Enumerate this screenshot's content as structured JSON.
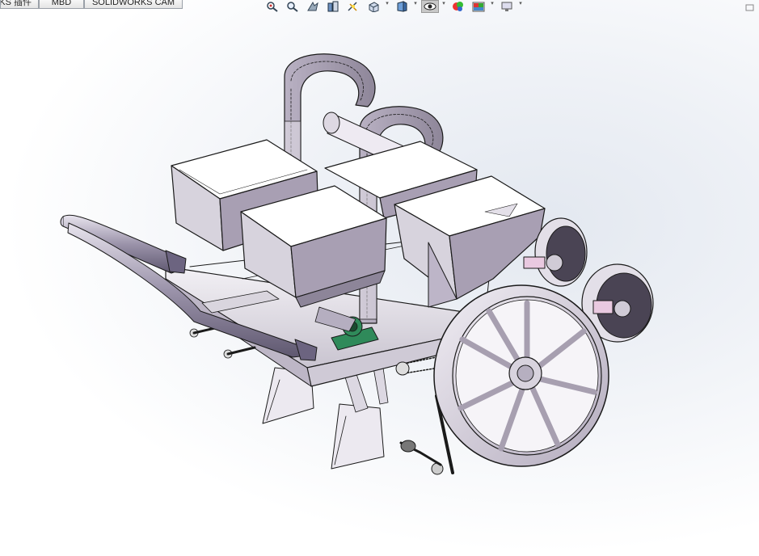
{
  "command_tabs": [
    {
      "label": "KS 插件"
    },
    {
      "label": "MBD"
    },
    {
      "label": "SOLIDWORKS CAM"
    }
  ],
  "view_toolbar": {
    "buttons": [
      {
        "icon": "zoom-to-fit-icon"
      },
      {
        "icon": "zoom-to-area-icon"
      },
      {
        "icon": "previous-view-icon"
      },
      {
        "icon": "section-view-icon"
      },
      {
        "icon": "dynamic-annotation-icon"
      },
      {
        "icon": "view-orientation-icon"
      },
      {
        "icon": "display-style-icon"
      },
      {
        "icon": "hide-show-items-icon"
      },
      {
        "icon": "edit-appearance-icon"
      },
      {
        "icon": "apply-scene-icon"
      },
      {
        "icon": "view-settings-icon"
      }
    ]
  },
  "viewport": {
    "model": "seeder-planter-assembly",
    "colors": {
      "body": "#d9d6de",
      "body_dark": "#a79fb0",
      "edge": "#1a1a1a",
      "bearing_green": "#2f8a5a",
      "pink_block": "#e9c9e0"
    }
  }
}
